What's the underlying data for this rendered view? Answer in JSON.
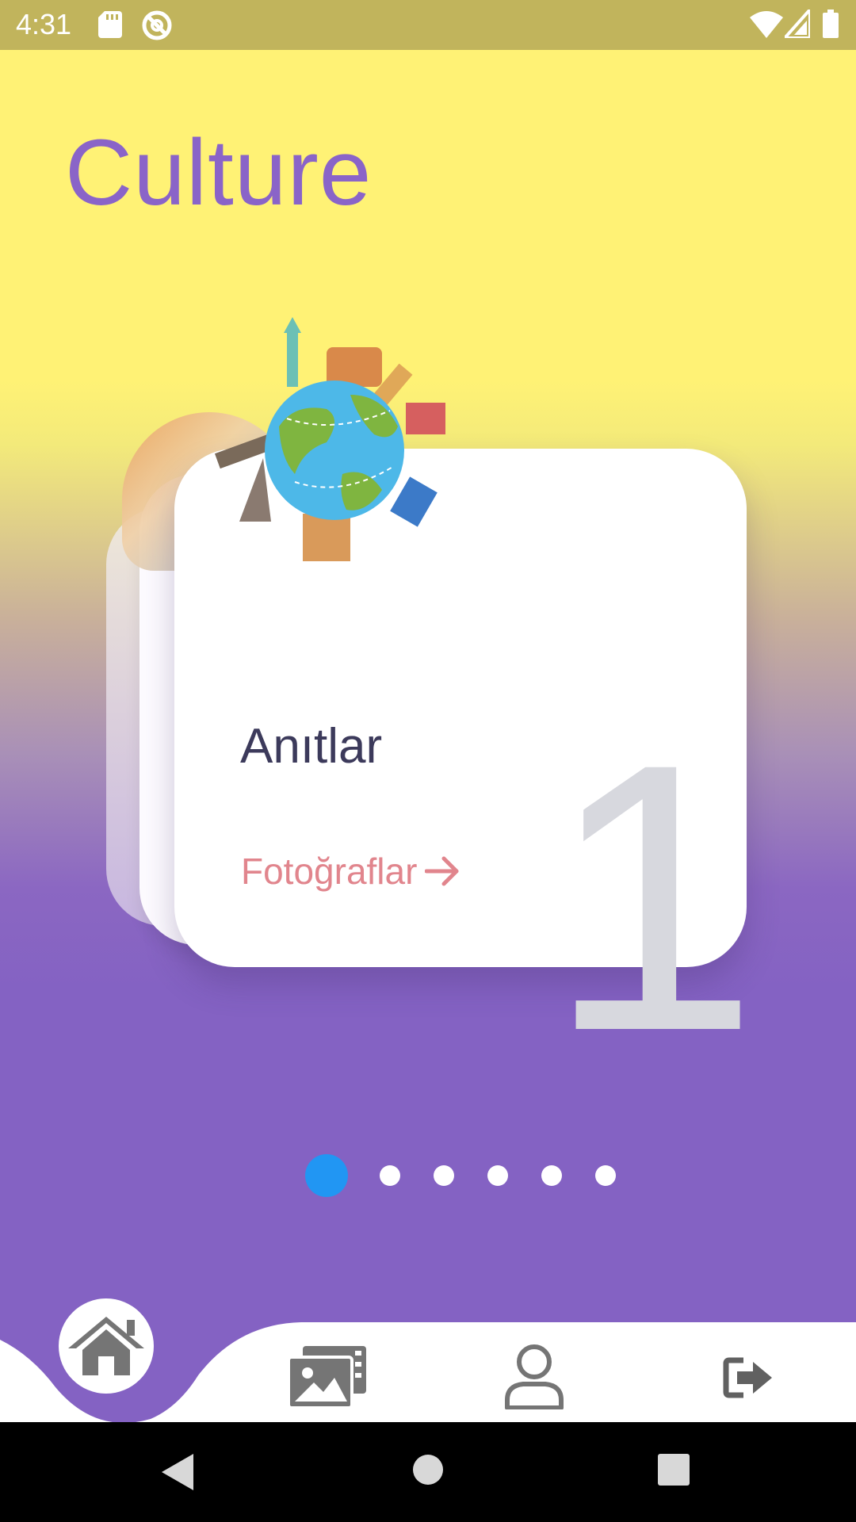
{
  "status_bar": {
    "time": "4:31",
    "icons": [
      "sd-card-icon",
      "sync-off-icon",
      "wifi-icon",
      "signal-icon",
      "battery-icon"
    ]
  },
  "header": {
    "title": "Culture"
  },
  "card": {
    "number": "1",
    "title": "Anıtlar",
    "link_label": "Fotoğraflar",
    "link_icon": "arrow-right-icon",
    "image": "globe-landmarks-illustration"
  },
  "pager": {
    "count": 6,
    "active_index": 0,
    "active_color": "#2196f3"
  },
  "bottom_nav": {
    "items": [
      {
        "icon": "home-icon",
        "active": true
      },
      {
        "icon": "gallery-icon",
        "active": false
      },
      {
        "icon": "profile-icon",
        "active": false
      },
      {
        "icon": "logout-icon",
        "active": false
      }
    ],
    "accent": "#8462c3"
  },
  "colors": {
    "title": "#8a64c8",
    "background_top": "#fff275",
    "background_bottom": "#8462c3",
    "link": "#e1858d"
  }
}
